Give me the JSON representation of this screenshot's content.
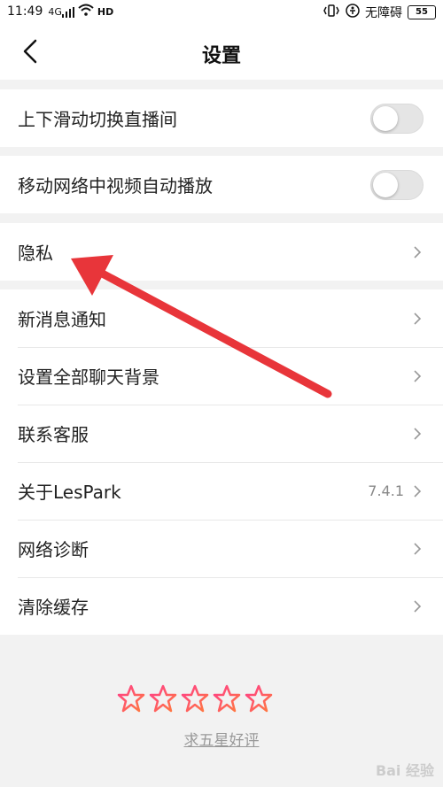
{
  "status_bar": {
    "time": "11:49",
    "signal_label": "4G",
    "hd_label": "HD",
    "network_status": "无障碍",
    "battery": "55"
  },
  "nav": {
    "title": "设置",
    "back_icon": "chevron-left-icon"
  },
  "toggles": [
    {
      "label": "上下滑动切换直播间",
      "on": false
    },
    {
      "label": "移动网络中视频自动播放",
      "on": false
    }
  ],
  "privacy": {
    "label": "隐私"
  },
  "menu_items": [
    {
      "label": "新消息通知",
      "value": ""
    },
    {
      "label": "设置全部聊天背景",
      "value": ""
    },
    {
      "label": "联系客服",
      "value": ""
    },
    {
      "label": "关于LesPark",
      "value": "7.4.1"
    },
    {
      "label": "网络诊断",
      "value": ""
    },
    {
      "label": "清除缓存",
      "value": ""
    }
  ],
  "rating": {
    "star_count": 5,
    "link_text": "求五星好评"
  },
  "watermark": "Bai 经验",
  "colors": {
    "accent_star_start": "#ff3d8b",
    "accent_star_end": "#ff7a3d",
    "arrow": "#e8353a"
  }
}
